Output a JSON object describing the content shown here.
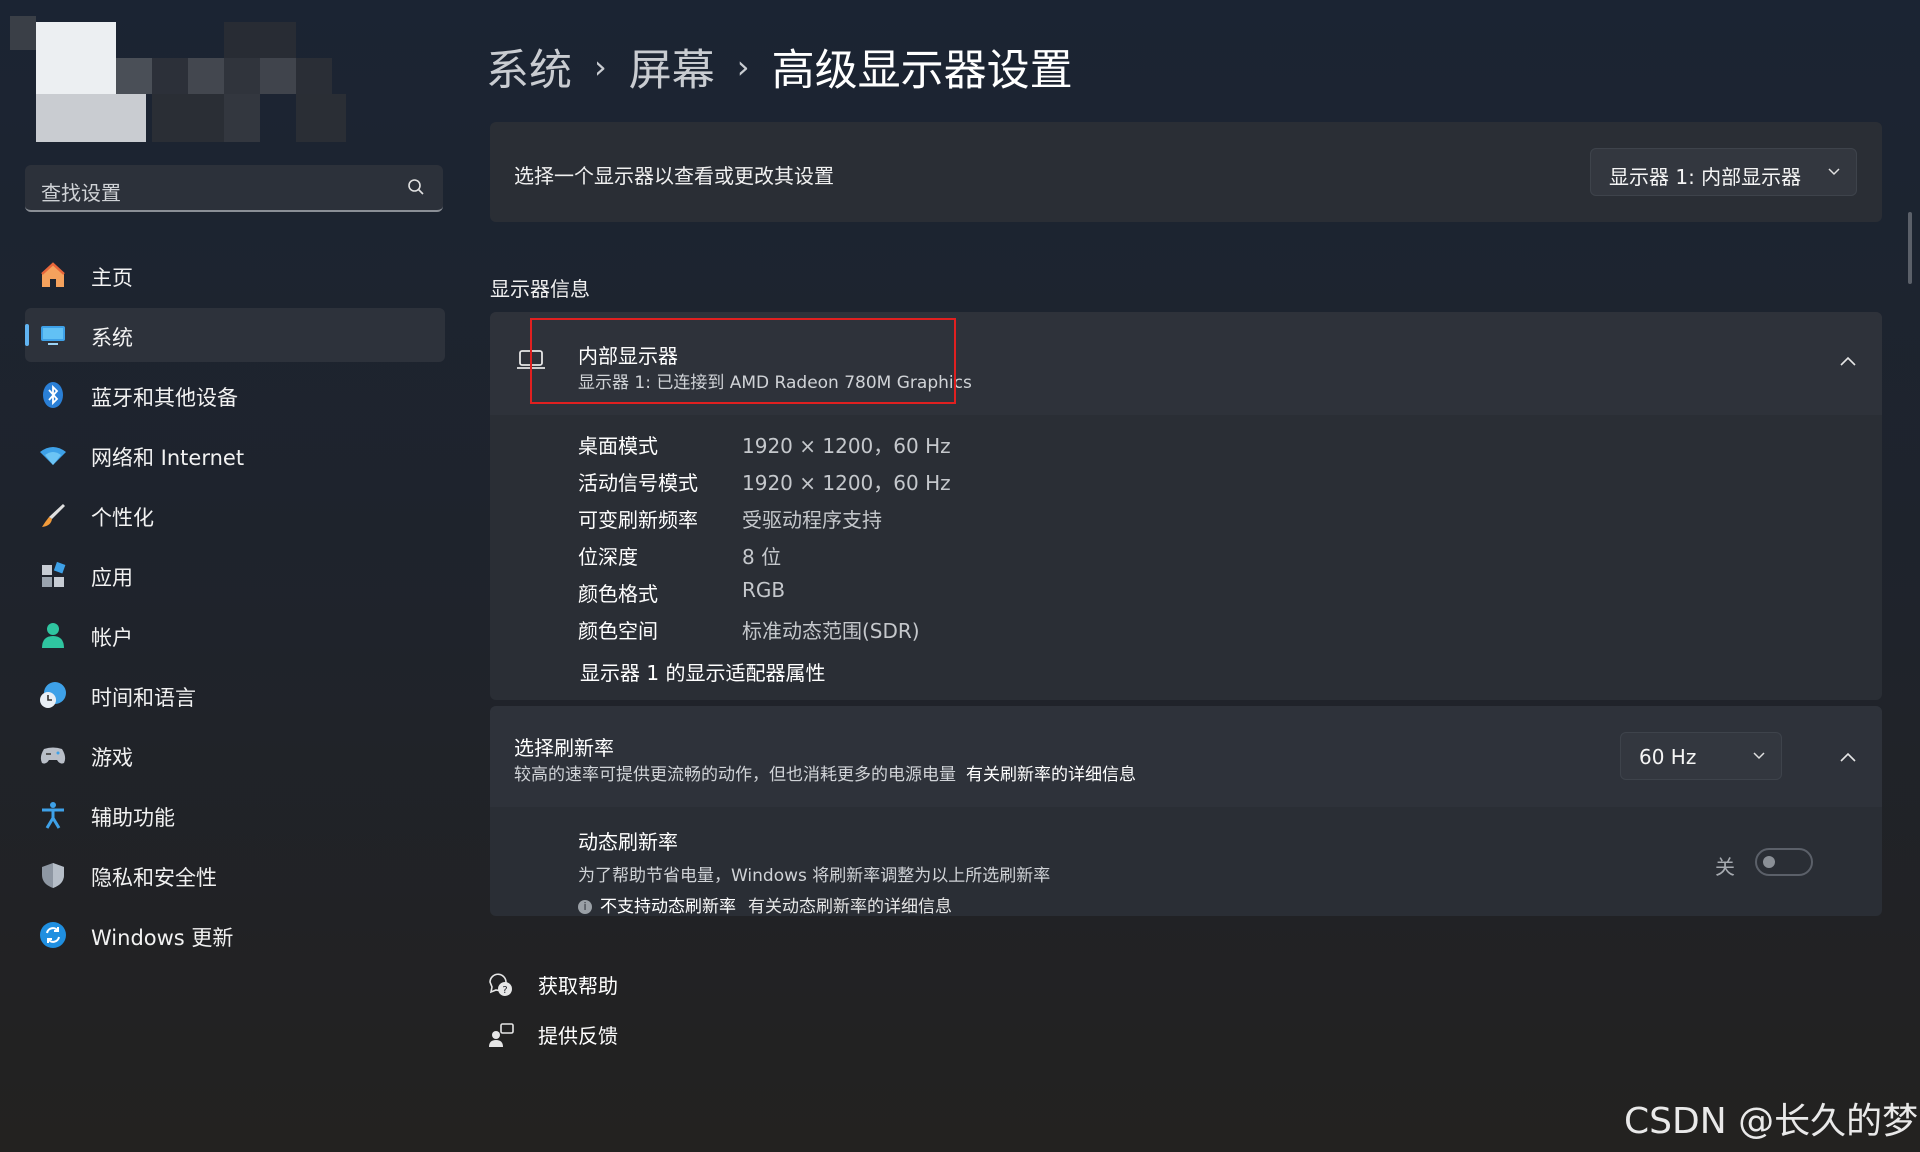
{
  "sidebar": {
    "search_placeholder": "查找设置",
    "items": [
      {
        "label": "主页",
        "icon": "home-icon"
      },
      {
        "label": "系统",
        "icon": "system-display-icon"
      },
      {
        "label": "蓝牙和其他设备",
        "icon": "bluetooth-icon"
      },
      {
        "label": "网络和 Internet",
        "icon": "wifi-icon"
      },
      {
        "label": "个性化",
        "icon": "brush-icon"
      },
      {
        "label": "应用",
        "icon": "apps-icon"
      },
      {
        "label": "帐户",
        "icon": "account-icon"
      },
      {
        "label": "时间和语言",
        "icon": "clock-globe-icon"
      },
      {
        "label": "游戏",
        "icon": "gamepad-icon"
      },
      {
        "label": "辅助功能",
        "icon": "accessibility-icon"
      },
      {
        "label": "隐私和安全性",
        "icon": "shield-icon"
      },
      {
        "label": "Windows 更新",
        "icon": "update-icon"
      }
    ],
    "active_index": 1
  },
  "breadcrumb": {
    "c1": "系统",
    "c2": "屏幕",
    "c3": "高级显示器设置",
    "separator": "›"
  },
  "display_select": {
    "label": "选择一个显示器以查看或更改其设置",
    "value": "显示器 1: 内部显示器"
  },
  "display_info": {
    "section_title": "显示器信息",
    "name": "内部显示器",
    "subtitle": "显示器 1: 已连接到 AMD Radeon 780M Graphics",
    "rows": [
      {
        "key": "桌面模式",
        "value": "1920 × 1200，60 Hz"
      },
      {
        "key": "活动信号模式",
        "value": "1920 × 1200，60 Hz"
      },
      {
        "key": "可变刷新频率",
        "value": "受驱动程序支持"
      },
      {
        "key": "位深度",
        "value": "8 位"
      },
      {
        "key": "颜色格式",
        "value": "RGB"
      },
      {
        "key": "颜色空间",
        "value": "标准动态范围(SDR)"
      }
    ],
    "adapter_link": "显示器 1 的显示适配器属性"
  },
  "refresh_rate": {
    "title": "选择刷新率",
    "description": "较高的速率可提供更流畅的动作，但也消耗更多的电源电量",
    "more_info": "有关刷新率的详细信息",
    "value": "60 Hz",
    "dynamic": {
      "title": "动态刷新率",
      "description": "为了帮助节省电量，Windows 将刷新率调整为以上所选刷新率",
      "unsupported": "不支持动态刷新率",
      "more_info": "有关动态刷新率的详细信息",
      "toggle_label": "关"
    }
  },
  "footer": {
    "help": "获取帮助",
    "feedback": "提供反馈"
  },
  "watermark": "CSDN @长久的梦",
  "colors": {
    "accent": "#61b4f2",
    "highlight_box": "#e02020"
  }
}
